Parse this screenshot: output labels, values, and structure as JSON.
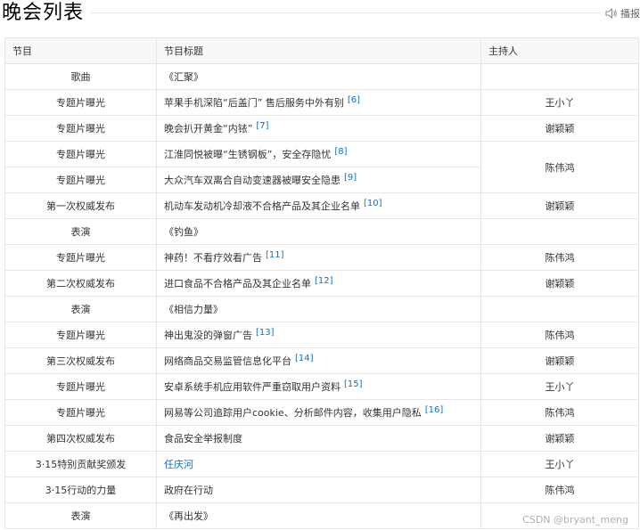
{
  "page": {
    "title": "晚会列表",
    "audio_label": "播报"
  },
  "table": {
    "headers": [
      "节目",
      "节目标题",
      "主持人"
    ],
    "rows": [
      {
        "type": "歌曲",
        "title": "《汇聚》",
        "ref": "",
        "host": ""
      },
      {
        "type": "专题片曝光",
        "title": "苹果手机深陷“后盖门” 售后服务中外有别",
        "ref": "[6]",
        "host": "王小丫"
      },
      {
        "type": "专题片曝光",
        "title": "晚会扒开黄金“内铱”",
        "ref": "[7]",
        "host": "谢颖颖"
      },
      {
        "type": "专题片曝光",
        "title": "江淮同悦被曝“生锈钢板”，安全存隐忧",
        "ref": "[8]",
        "host": "陈伟鸿"
      },
      {
        "type": "专题片曝光",
        "title": "大众汽车双离合自动变速器被曝安全隐患",
        "ref": "[9]",
        "host": null
      },
      {
        "type": "第一次权威发布",
        "title": "机动车发动机冷却液不合格产品及其企业名单",
        "ref": "[10]",
        "host": "谢颖颖"
      },
      {
        "type": "表演",
        "title": "《钓鱼》",
        "ref": "",
        "host": ""
      },
      {
        "type": "专题片曝光",
        "title": "神药！不看疗效看广告",
        "ref": "[11]",
        "host": "陈伟鸿"
      },
      {
        "type": "第二次权威发布",
        "title": "进口食品不合格产品及其企业名单",
        "ref": "[12]",
        "host": "谢颖颖"
      },
      {
        "type": "表演",
        "title": "《相信力量》",
        "ref": "",
        "host": ""
      },
      {
        "type": "专题片曝光",
        "title": "神出鬼没的弹窗广告",
        "ref": "[13]",
        "host": "陈伟鸿"
      },
      {
        "type": "第三次权威发布",
        "title": "网络商品交易监管信息化平台",
        "ref": "[14]",
        "host": "谢颖颖"
      },
      {
        "type": "专题片曝光",
        "title": "安卓系统手机应用软件严重窃取用户资料",
        "ref": "[15]",
        "host": "王小丫"
      },
      {
        "type": "专题片曝光",
        "title": "网易等公司追踪用户cookie、分析邮件内容，收集用户隐私",
        "ref": "[16]",
        "host": "陈伟鸿"
      },
      {
        "type": "第四次权威发布",
        "title": "食品安全举报制度",
        "ref": "",
        "host": "谢颖颖"
      },
      {
        "type": "3·15特别贡献奖颁发",
        "title": "任庆河",
        "ref": "",
        "host": "王小丫",
        "link": true
      },
      {
        "type": "3·15行动的力量",
        "title": "政府在行动",
        "ref": "",
        "host": "陈伟鸿"
      },
      {
        "type": "表演",
        "title": "《再出发》",
        "ref": "",
        "host": ""
      }
    ]
  },
  "watermark": "CSDN @bryant_meng"
}
